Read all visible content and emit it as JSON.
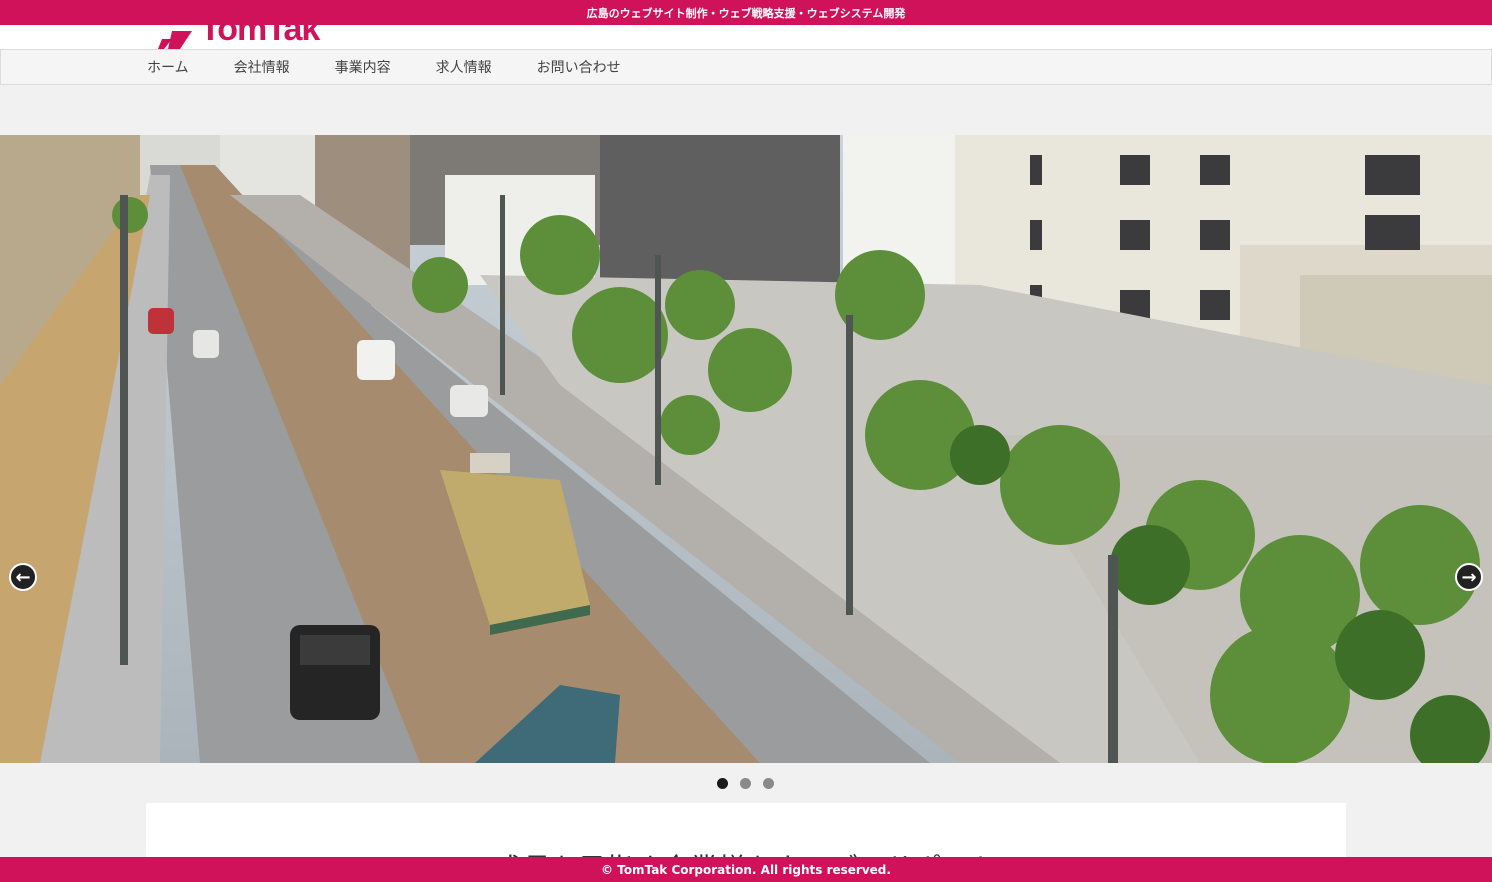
{
  "topbar": {
    "tagline": "広島のウェブサイト制作・ウェブ戦略支援・ウェブシステム開発"
  },
  "header": {
    "logo_text": "TomTak"
  },
  "nav": {
    "items": [
      {
        "label": "ホーム"
      },
      {
        "label": "会社情報"
      },
      {
        "label": "事業内容"
      },
      {
        "label": "求人情報"
      },
      {
        "label": "お問い合わせ"
      }
    ]
  },
  "slider": {
    "prev_label": "←",
    "next_label": "→",
    "slide_count": 3,
    "active_slide": 1
  },
  "content": {
    "heading": "成長を目指す企業様をウェブでサポート"
  },
  "footer": {
    "copyright": "© TomTak Corporation. All rights reserved."
  },
  "colors": {
    "brand": "#d0125a",
    "nav_bg": "#f5f5f5",
    "page_bg": "#f1f1f1"
  }
}
